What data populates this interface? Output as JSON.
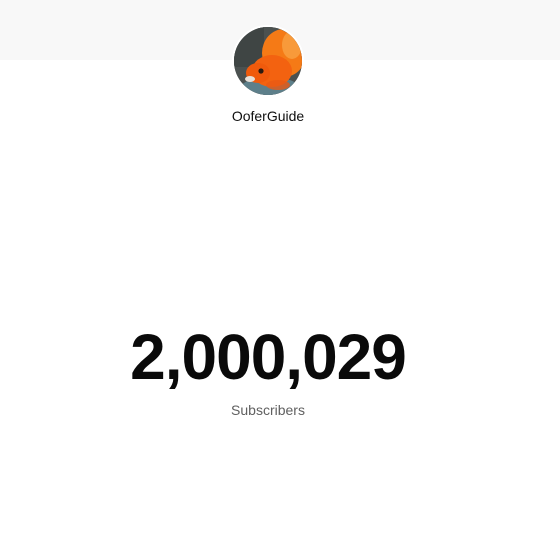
{
  "channel": {
    "name": "OoferGuide",
    "avatar_icon": "goldfish-avatar"
  },
  "stats": {
    "subscriber_count": "2,000,029",
    "subscriber_label": "Subscribers"
  },
  "colors": {
    "background": "#ffffff",
    "top_band": "#f8f8f8",
    "count_text": "#0a0a0a",
    "label_text": "#606060",
    "avatar_fish": "#f26a10"
  }
}
